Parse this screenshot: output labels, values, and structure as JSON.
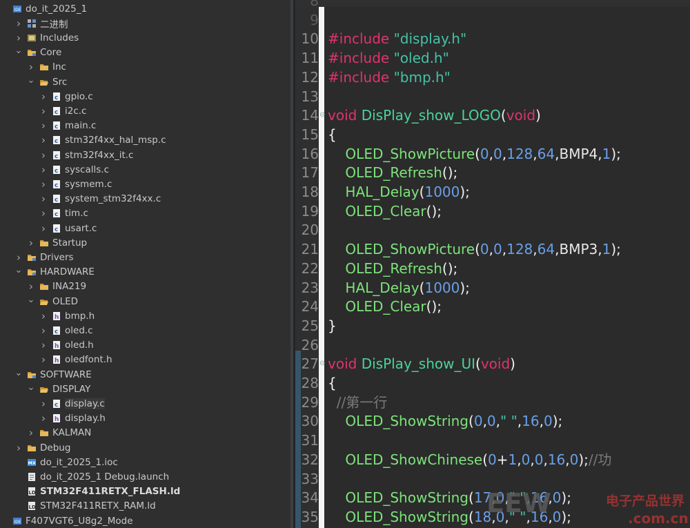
{
  "explorer": {
    "items": [
      {
        "label": "do_it_2025_1",
        "depth": 0,
        "chevron": "none",
        "icon": "project-icon"
      },
      {
        "label": "二进制",
        "depth": 1,
        "chevron": "right",
        "icon": "binaries-icon"
      },
      {
        "label": "Includes",
        "depth": 1,
        "chevron": "right",
        "icon": "includes-icon"
      },
      {
        "label": "Core",
        "depth": 1,
        "chevron": "down",
        "icon": "source-folder-icon"
      },
      {
        "label": "Inc",
        "depth": 2,
        "chevron": "right",
        "icon": "folder-icon"
      },
      {
        "label": "Src",
        "depth": 2,
        "chevron": "down",
        "icon": "folder-open-icon"
      },
      {
        "label": "gpio.c",
        "depth": 3,
        "chevron": "right",
        "icon": "c-file-icon"
      },
      {
        "label": "i2c.c",
        "depth": 3,
        "chevron": "right",
        "icon": "c-file-icon"
      },
      {
        "label": "main.c",
        "depth": 3,
        "chevron": "right",
        "icon": "c-file-icon"
      },
      {
        "label": "stm32f4xx_hal_msp.c",
        "depth": 3,
        "chevron": "right",
        "icon": "c-file-icon"
      },
      {
        "label": "stm32f4xx_it.c",
        "depth": 3,
        "chevron": "right",
        "icon": "c-file-icon"
      },
      {
        "label": "syscalls.c",
        "depth": 3,
        "chevron": "right",
        "icon": "c-file-icon"
      },
      {
        "label": "sysmem.c",
        "depth": 3,
        "chevron": "right",
        "icon": "c-file-icon"
      },
      {
        "label": "system_stm32f4xx.c",
        "depth": 3,
        "chevron": "right",
        "icon": "c-file-icon"
      },
      {
        "label": "tim.c",
        "depth": 3,
        "chevron": "right",
        "icon": "c-file-icon"
      },
      {
        "label": "usart.c",
        "depth": 3,
        "chevron": "right",
        "icon": "c-file-icon"
      },
      {
        "label": "Startup",
        "depth": 2,
        "chevron": "right",
        "icon": "folder-icon"
      },
      {
        "label": "Drivers",
        "depth": 1,
        "chevron": "right",
        "icon": "source-folder-icon"
      },
      {
        "label": "HARDWARE",
        "depth": 1,
        "chevron": "down",
        "icon": "source-folder-icon"
      },
      {
        "label": "INA219",
        "depth": 2,
        "chevron": "right",
        "icon": "folder-icon"
      },
      {
        "label": "OLED",
        "depth": 2,
        "chevron": "down",
        "icon": "folder-open-icon"
      },
      {
        "label": "bmp.h",
        "depth": 3,
        "chevron": "right",
        "icon": "h-file-icon"
      },
      {
        "label": "oled.c",
        "depth": 3,
        "chevron": "right",
        "icon": "c-file-icon"
      },
      {
        "label": "oled.h",
        "depth": 3,
        "chevron": "right",
        "icon": "h-file-icon"
      },
      {
        "label": "oledfont.h",
        "depth": 3,
        "chevron": "right",
        "icon": "h-file-icon"
      },
      {
        "label": "SOFTWARE",
        "depth": 1,
        "chevron": "down",
        "icon": "source-folder-icon"
      },
      {
        "label": "DISPLAY",
        "depth": 2,
        "chevron": "down",
        "icon": "folder-open-icon"
      },
      {
        "label": "display.c",
        "depth": 3,
        "chevron": "right",
        "icon": "c-file-icon",
        "selected": true
      },
      {
        "label": "display.h",
        "depth": 3,
        "chevron": "right",
        "icon": "h-file-icon"
      },
      {
        "label": "KALMAN",
        "depth": 2,
        "chevron": "right",
        "icon": "folder-icon"
      },
      {
        "label": "Debug",
        "depth": 1,
        "chevron": "right",
        "icon": "folder-icon"
      },
      {
        "label": "do_it_2025_1.ioc",
        "depth": 1,
        "chevron": "none",
        "icon": "ioc-file-icon"
      },
      {
        "label": "do_it_2025_1 Debug.launch",
        "depth": 1,
        "chevron": "none",
        "icon": "launch-file-icon"
      },
      {
        "label": "STM32F411RETX_FLASH.ld",
        "depth": 1,
        "chevron": "none",
        "icon": "ld-file-icon",
        "bold": true
      },
      {
        "label": "STM32F411RETX_RAM.ld",
        "depth": 1,
        "chevron": "none",
        "icon": "ld-file-icon"
      },
      {
        "label": "F407VGT6_U8g2_Mode",
        "depth": 0,
        "chevron": "none",
        "icon": "project-icon"
      }
    ]
  },
  "editor": {
    "lines": [
      {
        "n": "8",
        "dim": true,
        "tokens": []
      },
      {
        "n": "9",
        "dim": true,
        "tokens": []
      },
      {
        "n": "10",
        "tokens": [
          {
            "t": "#include",
            "c": "kw-include"
          },
          {
            "t": " ",
            "c": "punc"
          },
          {
            "t": "\"display.h\"",
            "c": "str"
          }
        ]
      },
      {
        "n": "11",
        "tokens": [
          {
            "t": "#include",
            "c": "kw-include"
          },
          {
            "t": " ",
            "c": "punc"
          },
          {
            "t": "\"oled.h\"",
            "c": "str"
          }
        ]
      },
      {
        "n": "12",
        "tokens": [
          {
            "t": "#include",
            "c": "kw-include"
          },
          {
            "t": " ",
            "c": "punc"
          },
          {
            "t": "\"bmp.h\"",
            "c": "str"
          }
        ]
      },
      {
        "n": "13",
        "tokens": []
      },
      {
        "n": "14",
        "fold": true,
        "tokens": [
          {
            "t": "void",
            "c": "kw-type"
          },
          {
            "t": " ",
            "c": "punc"
          },
          {
            "t": "DisPlay_show_LOGO",
            "c": "fn-def"
          },
          {
            "t": "(",
            "c": "punc"
          },
          {
            "t": "void",
            "c": "kw-type"
          },
          {
            "t": ")",
            "c": "punc"
          }
        ]
      },
      {
        "n": "15",
        "tokens": [
          {
            "t": "{",
            "c": "punc"
          }
        ]
      },
      {
        "n": "16",
        "tokens": [
          {
            "t": "    OLED_ShowPicture",
            "c": "fn-call"
          },
          {
            "t": "(",
            "c": "punc"
          },
          {
            "t": "0",
            "c": "num"
          },
          {
            "t": ",",
            "c": "punc"
          },
          {
            "t": "0",
            "c": "num"
          },
          {
            "t": ",",
            "c": "punc"
          },
          {
            "t": "128",
            "c": "num"
          },
          {
            "t": ",",
            "c": "punc"
          },
          {
            "t": "64",
            "c": "num"
          },
          {
            "t": ",",
            "c": "punc"
          },
          {
            "t": "BMP4",
            "c": "ident"
          },
          {
            "t": ",",
            "c": "punc"
          },
          {
            "t": "1",
            "c": "num"
          },
          {
            "t": ");",
            "c": "punc"
          }
        ]
      },
      {
        "n": "17",
        "tokens": [
          {
            "t": "    OLED_Refresh",
            "c": "fn-call"
          },
          {
            "t": "();",
            "c": "punc"
          }
        ]
      },
      {
        "n": "18",
        "tokens": [
          {
            "t": "    HAL_Delay",
            "c": "fn-call"
          },
          {
            "t": "(",
            "c": "punc"
          },
          {
            "t": "1000",
            "c": "num"
          },
          {
            "t": ");",
            "c": "punc"
          }
        ]
      },
      {
        "n": "19",
        "tokens": [
          {
            "t": "    OLED_Clear",
            "c": "fn-call"
          },
          {
            "t": "();",
            "c": "punc"
          }
        ]
      },
      {
        "n": "20",
        "tokens": []
      },
      {
        "n": "21",
        "tokens": [
          {
            "t": "    OLED_ShowPicture",
            "c": "fn-call"
          },
          {
            "t": "(",
            "c": "punc"
          },
          {
            "t": "0",
            "c": "num"
          },
          {
            "t": ",",
            "c": "punc"
          },
          {
            "t": "0",
            "c": "num"
          },
          {
            "t": ",",
            "c": "punc"
          },
          {
            "t": "128",
            "c": "num"
          },
          {
            "t": ",",
            "c": "punc"
          },
          {
            "t": "64",
            "c": "num"
          },
          {
            "t": ",",
            "c": "punc"
          },
          {
            "t": "BMP3",
            "c": "ident"
          },
          {
            "t": ",",
            "c": "punc"
          },
          {
            "t": "1",
            "c": "num"
          },
          {
            "t": ");",
            "c": "punc"
          }
        ]
      },
      {
        "n": "22",
        "tokens": [
          {
            "t": "    OLED_Refresh",
            "c": "fn-call"
          },
          {
            "t": "();",
            "c": "punc"
          }
        ]
      },
      {
        "n": "23",
        "tokens": [
          {
            "t": "    HAL_Delay",
            "c": "fn-call"
          },
          {
            "t": "(",
            "c": "punc"
          },
          {
            "t": "1000",
            "c": "num"
          },
          {
            "t": ");",
            "c": "punc"
          }
        ]
      },
      {
        "n": "24",
        "tokens": [
          {
            "t": "    OLED_Clear",
            "c": "fn-call"
          },
          {
            "t": "();",
            "c": "punc"
          }
        ]
      },
      {
        "n": "25",
        "tokens": [
          {
            "t": "}",
            "c": "punc"
          }
        ]
      },
      {
        "n": "26",
        "tokens": []
      },
      {
        "n": "27",
        "fold": true,
        "tokens": [
          {
            "t": "void",
            "c": "kw-type"
          },
          {
            "t": " ",
            "c": "punc"
          },
          {
            "t": "DisPlay_show_UI",
            "c": "fn-def"
          },
          {
            "t": "(",
            "c": "punc"
          },
          {
            "t": "void",
            "c": "kw-type"
          },
          {
            "t": ")",
            "c": "punc"
          }
        ]
      },
      {
        "n": "28",
        "tokens": [
          {
            "t": "{",
            "c": "punc"
          }
        ]
      },
      {
        "n": "29",
        "tokens": [
          {
            "t": "  //第一行",
            "c": "comment"
          }
        ]
      },
      {
        "n": "30",
        "tokens": [
          {
            "t": "    OLED_ShowString",
            "c": "fn-call"
          },
          {
            "t": "(",
            "c": "punc"
          },
          {
            "t": "0",
            "c": "num"
          },
          {
            "t": ",",
            "c": "punc"
          },
          {
            "t": "0",
            "c": "num"
          },
          {
            "t": ",",
            "c": "punc"
          },
          {
            "t": "\" \"",
            "c": "str"
          },
          {
            "t": ",",
            "c": "punc"
          },
          {
            "t": "16",
            "c": "num"
          },
          {
            "t": ",",
            "c": "punc"
          },
          {
            "t": "0",
            "c": "num"
          },
          {
            "t": ");",
            "c": "punc"
          }
        ]
      },
      {
        "n": "31",
        "tokens": []
      },
      {
        "n": "32",
        "tokens": [
          {
            "t": "    OLED_ShowChinese",
            "c": "fn-call"
          },
          {
            "t": "(",
            "c": "punc"
          },
          {
            "t": "0",
            "c": "num"
          },
          {
            "t": "+",
            "c": "punc"
          },
          {
            "t": "1",
            "c": "num"
          },
          {
            "t": ",",
            "c": "punc"
          },
          {
            "t": "0",
            "c": "num"
          },
          {
            "t": ",",
            "c": "punc"
          },
          {
            "t": "0",
            "c": "num"
          },
          {
            "t": ",",
            "c": "punc"
          },
          {
            "t": "16",
            "c": "num"
          },
          {
            "t": ",",
            "c": "punc"
          },
          {
            "t": "0",
            "c": "num"
          },
          {
            "t": ");",
            "c": "punc"
          },
          {
            "t": "//功",
            "c": "comment"
          }
        ]
      },
      {
        "n": "33",
        "tokens": []
      },
      {
        "n": "34",
        "tokens": [
          {
            "t": "    OLED_ShowString",
            "c": "fn-call"
          },
          {
            "t": "(",
            "c": "punc"
          },
          {
            "t": "17",
            "c": "num"
          },
          {
            "t": ",",
            "c": "punc"
          },
          {
            "t": "0",
            "c": "num"
          },
          {
            "t": ",",
            "c": "punc"
          },
          {
            "t": "\" \"",
            "c": "str"
          },
          {
            "t": ",",
            "c": "punc"
          },
          {
            "t": "16",
            "c": "num"
          },
          {
            "t": ",",
            "c": "punc"
          },
          {
            "t": "0",
            "c": "num"
          },
          {
            "t": ");",
            "c": "punc"
          }
        ]
      },
      {
        "n": "35",
        "tokens": [
          {
            "t": "    OLED_ShowString",
            "c": "fn-call"
          },
          {
            "t": "(",
            "c": "punc"
          },
          {
            "t": "18",
            "c": "num"
          },
          {
            "t": ",",
            "c": "punc"
          },
          {
            "t": "0",
            "c": "num"
          },
          {
            "t": ",",
            "c": "punc"
          },
          {
            "t": "\" \"",
            "c": "str"
          },
          {
            "t": ",",
            "c": "punc"
          },
          {
            "t": "16",
            "c": "num"
          },
          {
            "t": ",",
            "c": "punc"
          },
          {
            "t": "0",
            "c": "num"
          },
          {
            "t": ");",
            "c": "punc"
          }
        ]
      }
    ]
  },
  "watermark": {
    "brand": "EEW",
    "cn_text": "电子产品世界",
    "domain": ".com.cn"
  }
}
